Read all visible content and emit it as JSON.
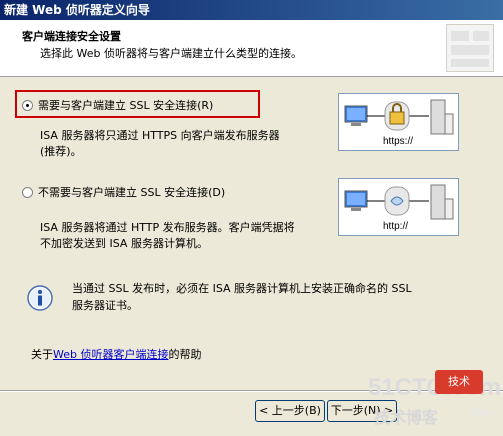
{
  "window": {
    "title": "新建 Web 侦听器定义向导"
  },
  "header": {
    "title": "客户端连接安全设置",
    "subtitle": "选择此 Web 侦听器将与客户端建立什么类型的连接。"
  },
  "options": [
    {
      "label": "需要与客户端建立 SSL 安全连接(R)",
      "checked": true,
      "description_line1": "ISA 服务器将只通过 HTTPS 向客户端发布服务器",
      "description_line2": "(推荐)。",
      "protocol_label": "https://"
    },
    {
      "label": "不需要与客户端建立 SSL 安全连接(D)",
      "checked": false,
      "description_line1": "ISA 服务器将通过 HTTP 发布服务器。客户端凭据将",
      "description_line2": "不加密发送到 ISA 服务器计算机。",
      "protocol_label": "http://"
    }
  ],
  "info": {
    "icon": "info-icon",
    "line1": "当通过 SSL 发布时，必须在 ISA 服务器计算机上安装正确命名的 SSL",
    "line2": "服务器证书。"
  },
  "help": {
    "prefix": "关于",
    "link": "Web 侦听器客户端连接",
    "suffix": "的帮助"
  },
  "buttons": {
    "back": "< 上一步(B)",
    "next": "下一步(N) >"
  },
  "watermark": {
    "site": "51CTO.com",
    "tagline": "技术博客",
    "blog": "Blog",
    "badge": "技术"
  },
  "colors": {
    "title_bar": "#0a246a",
    "highlight_box": "#cc0000",
    "link": "#0000cc"
  }
}
